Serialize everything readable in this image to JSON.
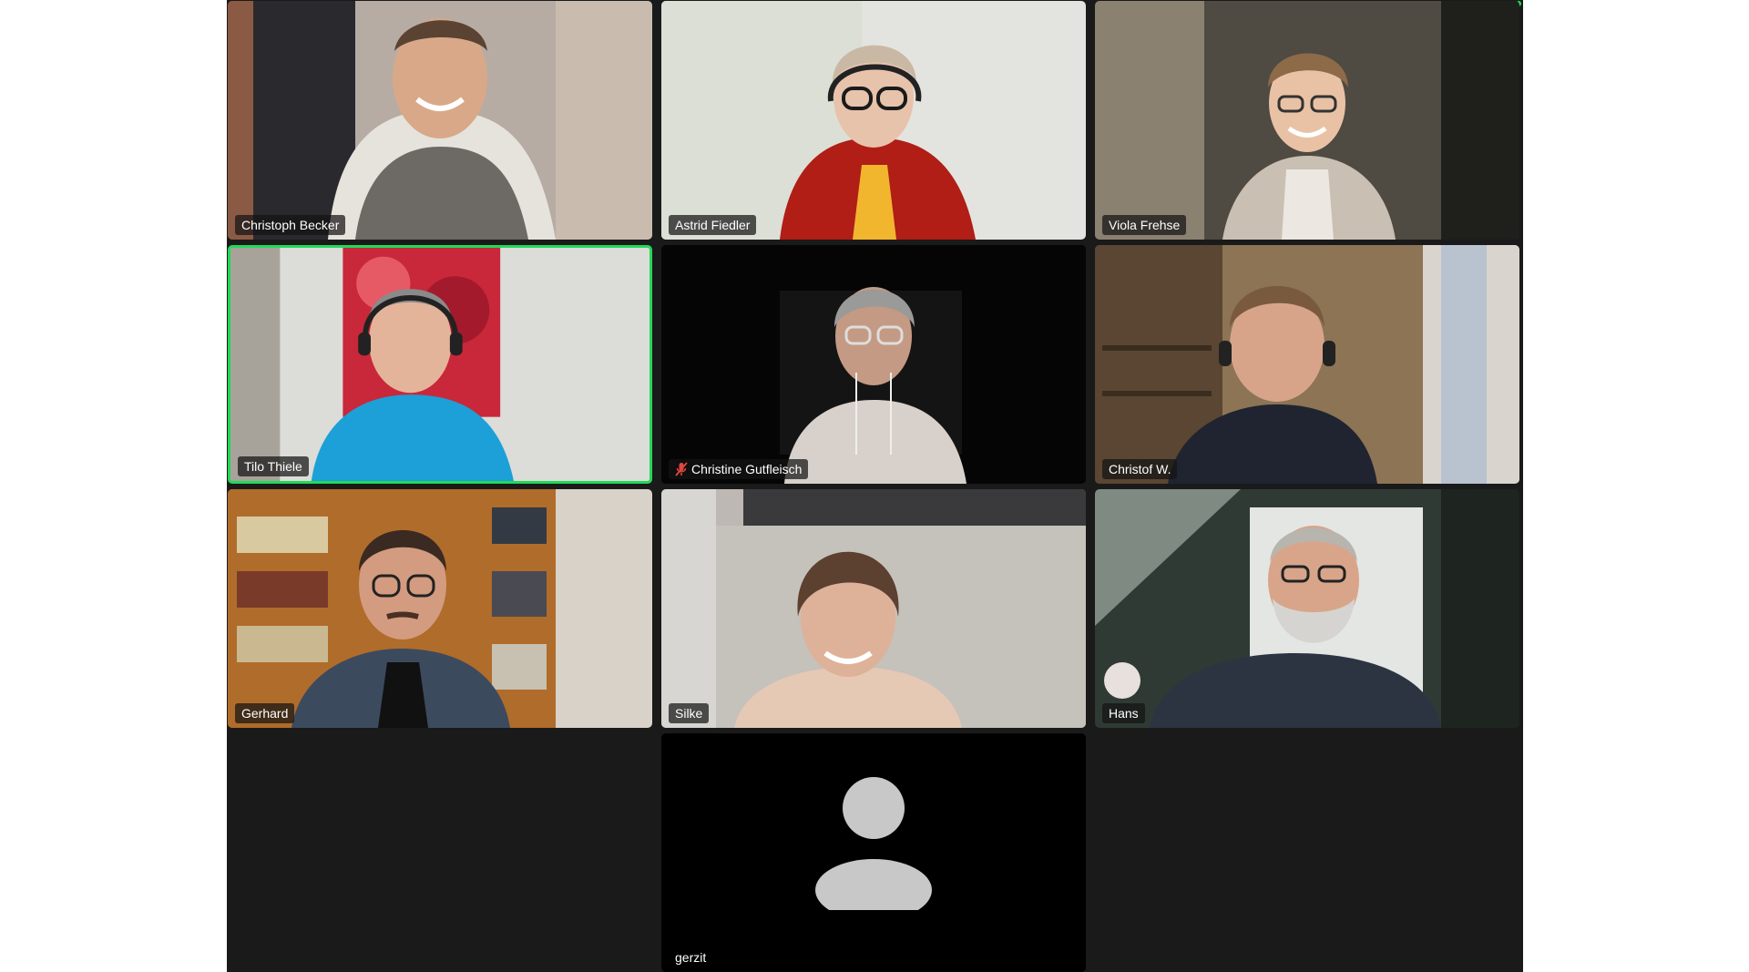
{
  "meeting": {
    "accent_color": "#23d959",
    "participants": [
      {
        "name": "Christoph Becker",
        "muted": false,
        "video_on": true,
        "active_speaker": false
      },
      {
        "name": "Astrid Fiedler",
        "muted": false,
        "video_on": true,
        "active_speaker": false
      },
      {
        "name": "Viola Frehse",
        "muted": false,
        "video_on": true,
        "active_speaker": false
      },
      {
        "name": "Tilo Thiele",
        "muted": false,
        "video_on": true,
        "active_speaker": true
      },
      {
        "name": "Christine Gutfleisch",
        "muted": true,
        "video_on": true,
        "active_speaker": false
      },
      {
        "name": "Christof W.",
        "muted": false,
        "video_on": true,
        "active_speaker": false
      },
      {
        "name": "Gerhard",
        "muted": false,
        "video_on": true,
        "active_speaker": false
      },
      {
        "name": "Silke",
        "muted": false,
        "video_on": true,
        "active_speaker": false
      },
      {
        "name": "Hans",
        "muted": false,
        "video_on": true,
        "active_speaker": false
      },
      {
        "name": "gerzit",
        "muted": false,
        "video_on": false,
        "active_speaker": false
      }
    ]
  }
}
